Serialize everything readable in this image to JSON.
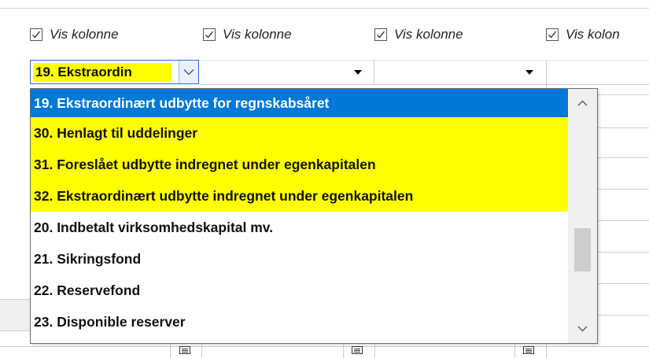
{
  "checkboxes": [
    {
      "label": "Vis kolonne",
      "checked": true
    },
    {
      "label": "Vis kolonne",
      "checked": true
    },
    {
      "label": "Vis kolonne",
      "checked": true
    },
    {
      "label": "Vis kolon",
      "checked": true
    }
  ],
  "combo": {
    "selected_value": "19. Ekstraordin"
  },
  "dropdown": {
    "items": [
      {
        "label": "19. Ekstraordinært udbytte for regnskabsåret",
        "state": "selected"
      },
      {
        "label": "30. Henlagt til uddelinger",
        "state": "highlight"
      },
      {
        "label": "31. Foreslået udbytte indregnet under egenkapitalen",
        "state": "highlight"
      },
      {
        "label": "32. Ekstraordinært udbytte indregnet under egenkapitalen",
        "state": "highlight"
      },
      {
        "label": "20. Indbetalt virksomhedskapital mv.",
        "state": "normal"
      },
      {
        "label": "21. Sikringsfond",
        "state": "normal"
      },
      {
        "label": "22. Reservefond",
        "state": "normal"
      },
      {
        "label": "23. Disponible reserver",
        "state": "normal"
      }
    ],
    "scroll_position": 0.72,
    "scroll_visible_fraction": 0.22
  },
  "colors": {
    "selection": "#0078d7",
    "highlight": "#ffff00"
  }
}
